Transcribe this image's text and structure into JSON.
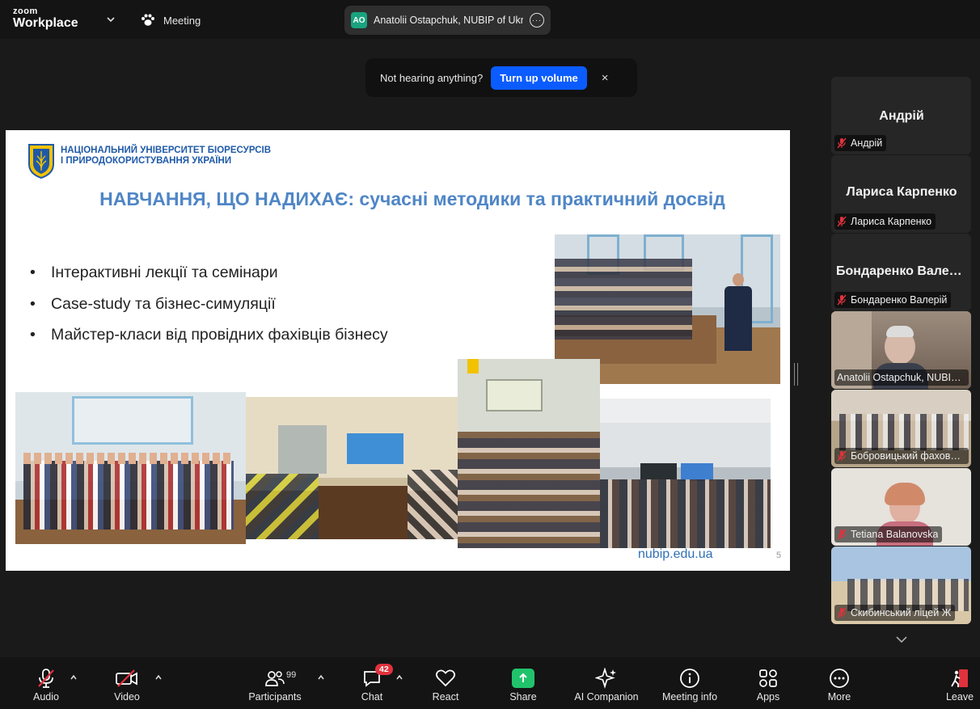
{
  "app": {
    "logo_line1": "zoom",
    "logo_line2": "Workplace",
    "meeting_label": "Meeting",
    "active_speaker_initials": "AO",
    "active_speaker_name": "Anatolii Ostapchuk, NUBIP of Ukraine"
  },
  "notice": {
    "text": "Not hearing anything?",
    "button": "Turn up volume",
    "close": "×"
  },
  "slide": {
    "org_line1": "НАЦІОНАЛЬНИЙ УНІВЕРСИТЕТ БІОРЕСУРСІВ",
    "org_line2": "І ПРИРОДОКОРИСТУВАННЯ УКРАЇНИ",
    "title": "НАВЧАННЯ, ЩО НАДИХАЄ: сучасні методики та практичний досвід",
    "bullets": [
      "Інтерактивні лекції та семінари",
      "Case-study та бізнес-симуляції",
      "Майстер-класи від провідних фахівців бізнесу"
    ],
    "bullet_symbol": "•",
    "url": "nubip.edu.ua",
    "page": "5"
  },
  "participants_panel": [
    {
      "big_name": "Андрій",
      "label": "Андрій",
      "muted": true,
      "video": false
    },
    {
      "big_name": "Лариса Карпенко",
      "label": "Лариса Карпенко",
      "muted": true,
      "video": false
    },
    {
      "big_name": "Бондаренко Валерій",
      "label": "Бондаренко Валерій",
      "muted": true,
      "video": false
    },
    {
      "big_name": "",
      "label": "Anatolii Ostapchuk, NUBIP of Ukraine",
      "muted": false,
      "video": true,
      "active": true
    },
    {
      "big_name": "",
      "label": "Бобровицький фаховий коледж",
      "muted": true,
      "video": true
    },
    {
      "big_name": "",
      "label": "Tetiana Balanovska",
      "muted": true,
      "video": true
    },
    {
      "big_name": "",
      "label": "Скибинський ліцей Ж",
      "muted": true,
      "video": true
    }
  ],
  "toolbar": {
    "audio": "Audio",
    "video": "Video",
    "participants": "Participants",
    "participants_count": "99",
    "chat": "Chat",
    "chat_badge": "42",
    "react": "React",
    "share": "Share",
    "ai_companion": "AI Companion",
    "meeting_info": "Meeting info",
    "apps": "Apps",
    "more": "More",
    "leave": "Leave"
  },
  "colors": {
    "accent_blue": "#0b5cff",
    "share_green": "#20c36b",
    "active_border": "#22c55e",
    "badge_red": "#e0323c",
    "muted_red": "#e0323c",
    "slide_title": "#4f86c6",
    "org_blue": "#1f5aa8"
  }
}
